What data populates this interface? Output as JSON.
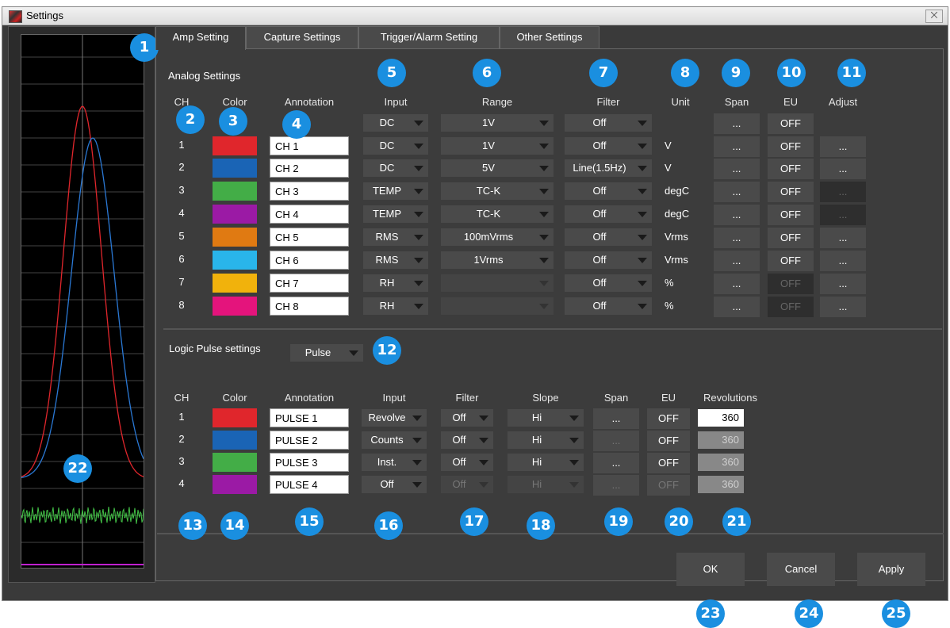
{
  "window": {
    "title": "Settings",
    "close_glyph": "⨉"
  },
  "tabs": [
    {
      "label": "Amp Setting"
    },
    {
      "label": "Capture Settings"
    },
    {
      "label": "Trigger/Alarm Setting"
    },
    {
      "label": "Other Settings"
    }
  ],
  "analog": {
    "section_title": "Analog Settings",
    "headers": {
      "ch": "CH",
      "color": "Color",
      "annotation": "Annotation",
      "input": "Input",
      "range": "Range",
      "filter": "Filter",
      "unit": "Unit",
      "span": "Span",
      "eu": "EU",
      "adjust": "Adjust"
    },
    "all_row": {
      "input": "DC",
      "range": "1V",
      "filter": "Off",
      "span": "...",
      "eu": "OFF"
    },
    "rows": [
      {
        "ch": "1",
        "color": "#e0262c",
        "annotation": "CH 1",
        "input": "DC",
        "range": "1V",
        "filter": "Off",
        "unit": "V",
        "span": "...",
        "eu": "OFF",
        "adjust": "..."
      },
      {
        "ch": "2",
        "color": "#1a64b5",
        "annotation": "CH 2",
        "input": "DC",
        "range": "5V",
        "filter": "Line(1.5Hz)",
        "unit": "V",
        "span": "...",
        "eu": "OFF",
        "adjust": "..."
      },
      {
        "ch": "3",
        "color": "#43ad47",
        "annotation": "CH 3",
        "input": "TEMP",
        "range": "TC-K",
        "filter": "Off",
        "unit": "degC",
        "span": "...",
        "eu": "OFF",
        "adjust": "..."
      },
      {
        "ch": "4",
        "color": "#9b1aa5",
        "annotation": "CH 4",
        "input": "TEMP",
        "range": "TC-K",
        "filter": "Off",
        "unit": "degC",
        "span": "...",
        "eu": "OFF",
        "adjust": "..."
      },
      {
        "ch": "5",
        "color": "#e07a12",
        "annotation": "CH 5",
        "input": "RMS",
        "range": "100mVrms",
        "filter": "Off",
        "unit": "Vrms",
        "span": "...",
        "eu": "OFF",
        "adjust": "..."
      },
      {
        "ch": "6",
        "color": "#29b5ea",
        "annotation": "CH 6",
        "input": "RMS",
        "range": "1Vrms",
        "filter": "Off",
        "unit": "Vrms",
        "span": "...",
        "eu": "OFF",
        "adjust": "..."
      },
      {
        "ch": "7",
        "color": "#f1b20c",
        "annotation": "CH 7",
        "input": "RH",
        "range": "",
        "filter": "Off",
        "unit": "%",
        "span": "...",
        "eu": "OFF",
        "adjust": "..."
      },
      {
        "ch": "8",
        "color": "#e4147c",
        "annotation": "CH 8",
        "input": "RH",
        "range": "",
        "filter": "Off",
        "unit": "%",
        "span": "...",
        "eu": "OFF",
        "adjust": "..."
      }
    ]
  },
  "logic": {
    "section_title": "Logic Pulse settings",
    "mode": "Pulse",
    "headers": {
      "ch": "CH",
      "color": "Color",
      "annotation": "Annotation",
      "input": "Input",
      "filter": "Filter",
      "slope": "Slope",
      "span": "Span",
      "eu": "EU",
      "revolutions": "Revolutions"
    },
    "rows": [
      {
        "ch": "1",
        "color": "#e0262c",
        "annotation": "PULSE 1",
        "input": "Revolve",
        "filter": "Off",
        "slope": "Hi",
        "span": "...",
        "eu": "OFF",
        "revolutions": "360"
      },
      {
        "ch": "2",
        "color": "#1a64b5",
        "annotation": "PULSE 2",
        "input": "Counts",
        "filter": "Off",
        "slope": "Hi",
        "span": "...",
        "eu": "OFF",
        "revolutions": "360"
      },
      {
        "ch": "3",
        "color": "#43ad47",
        "annotation": "PULSE 3",
        "input": "Inst.",
        "filter": "Off",
        "slope": "Hi",
        "span": "...",
        "eu": "OFF",
        "revolutions": "360"
      },
      {
        "ch": "4",
        "color": "#9b1aa5",
        "annotation": "PULSE 4",
        "input": "Off",
        "filter": "Off",
        "slope": "Hi",
        "span": "...",
        "eu": "OFF",
        "revolutions": "360"
      }
    ]
  },
  "buttons": {
    "ok": "OK",
    "cancel": "Cancel",
    "apply": "Apply"
  },
  "badges": [
    "1",
    "2",
    "3",
    "4",
    "5",
    "6",
    "7",
    "8",
    "9",
    "10",
    "11",
    "12",
    "13",
    "14",
    "15",
    "16",
    "17",
    "18",
    "19",
    "20",
    "21",
    "22",
    "23",
    "24",
    "25"
  ],
  "colors": {
    "badge": "#1a8fe0",
    "panel": "#3c3c3c",
    "control": "#4a4a4a"
  }
}
